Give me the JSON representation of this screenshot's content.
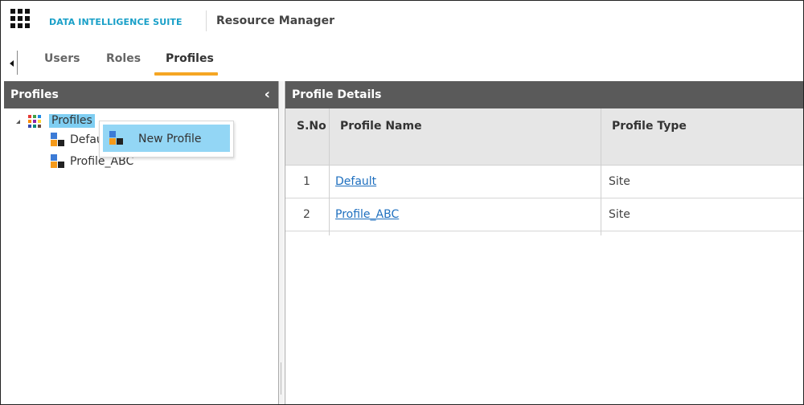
{
  "header": {
    "suite_name": "DATA INTELLIGENCE SUITE",
    "app_title": "Resource Manager"
  },
  "tabs": [
    {
      "label": "Users",
      "active": false
    },
    {
      "label": "Roles",
      "active": false
    },
    {
      "label": "Profiles",
      "active": true
    }
  ],
  "left_panel": {
    "title": "Profiles",
    "tree": {
      "root": {
        "label": "Profiles",
        "selected": true
      },
      "children": [
        {
          "label": "Defau"
        },
        {
          "label": "Profile_ABC"
        }
      ]
    },
    "context_menu": {
      "items": [
        {
          "label": "New Profile",
          "icon": "profile-icon"
        }
      ]
    }
  },
  "right_panel": {
    "title": "Profile Details",
    "columns": [
      "S.No",
      "Profile Name",
      "Profile Type"
    ],
    "rows": [
      {
        "sno": "1",
        "name": "Default",
        "type": "Site"
      },
      {
        "sno": "2",
        "name": "Profile_ABC",
        "type": "Site"
      }
    ]
  },
  "colors": {
    "accent_orange": "#f5a623",
    "suite_blue": "#1aa0c8",
    "panel_header": "#5a5a5a",
    "selection_blue": "#7fcef2",
    "link_blue": "#1e6fbf"
  }
}
